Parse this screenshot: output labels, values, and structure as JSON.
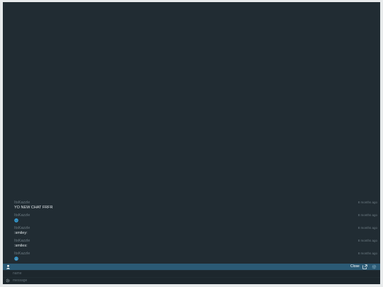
{
  "messages": [
    {
      "author": "ItsKazzle",
      "time": "8 months ago",
      "text": "YO NEW CHAT FRFR",
      "emoji": null
    },
    {
      "author": "ItsKazzle",
      "time": "8 months ago",
      "text": "",
      "emoji": "smiley-emoji"
    },
    {
      "author": "ItsKazzle",
      "time": "8 months ago",
      "text": ":smiley:",
      "emoji": null
    },
    {
      "author": "ItsKazzle",
      "time": "8 months ago",
      "text": ":smiles:",
      "emoji": null
    },
    {
      "author": "ItsKazzle",
      "time": "8 months ago",
      "text": "",
      "emoji": "grinning-emoji"
    }
  ],
  "toolbar": {
    "user_icon": "user-icon",
    "users_label": "Close",
    "popout_icon": "popout-icon",
    "settings_icon": "settings-icon",
    "accent_color": "#2b5a75"
  },
  "inputs": {
    "name_placeholder": "name",
    "message_placeholder": "message",
    "name_counter": " ",
    "message_counter": " "
  },
  "colors": {
    "background": "#212c33",
    "input_background": "#1d272d",
    "emoji": "#3aa6e0"
  }
}
